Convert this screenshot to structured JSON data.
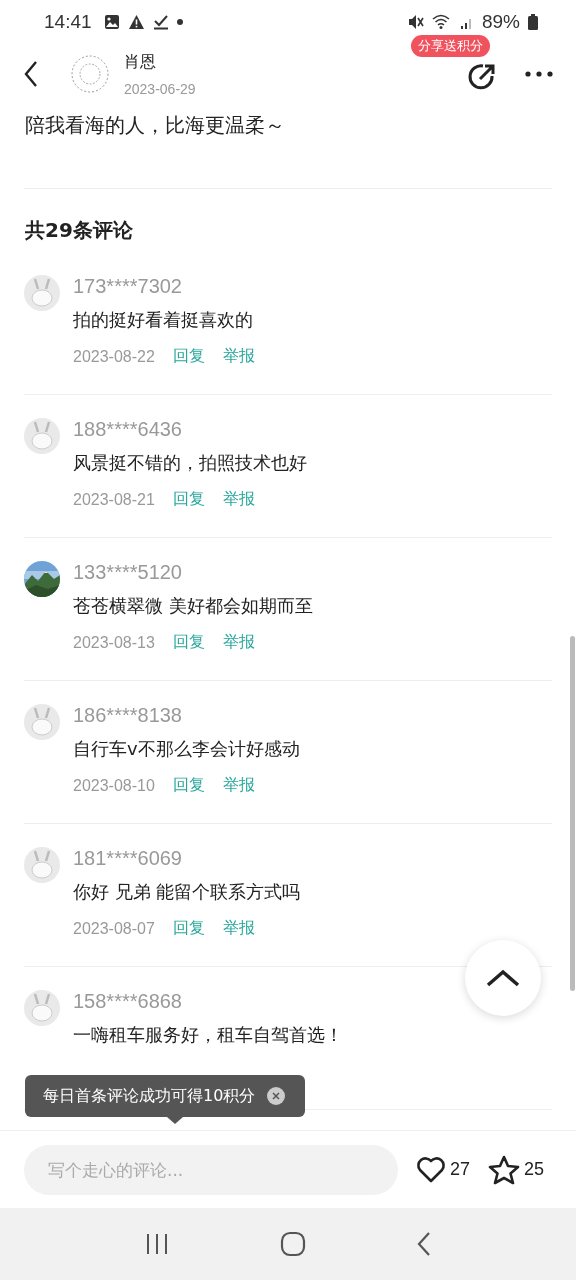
{
  "status_bar": {
    "time": "14:41",
    "battery": "89%"
  },
  "post": {
    "author": "肖恩",
    "date": "2023-06-29",
    "share_badge": "分享送积分",
    "text": "陪我看海的人，比海更温柔～"
  },
  "comments_heading": "共29条评论",
  "comments": [
    {
      "kind": "rabbit",
      "user": "173****7302",
      "text": "拍的挺好看着挺喜欢的",
      "date": "2023-08-22",
      "reply": "回复",
      "report": "举报"
    },
    {
      "kind": "rabbit",
      "user": "188****6436",
      "text": "风景挺不错的，拍照技术也好",
      "date": "2023-08-21",
      "reply": "回复",
      "report": "举报"
    },
    {
      "user": "133****5120",
      "text": "苍苍横翠微 美好都会如期而至",
      "date": "2023-08-13",
      "reply": "回复",
      "report": "举报"
    },
    {
      "kind": "rabbit",
      "user": "186****8138",
      "text": "自行车v不那么李会计好感动",
      "date": "2023-08-10",
      "reply": "回复",
      "report": "举报"
    },
    {
      "kind": "rabbit",
      "user": "181****6069",
      "text": "你好 兄弟 能留个联系方式吗",
      "date": "2023-08-07",
      "reply": "回复",
      "report": "举报"
    },
    {
      "kind": "rabbit",
      "user": "158****6868",
      "text": "一嗨租车服务好，租车自驾首选！"
    }
  ],
  "toast": {
    "text": "每日首条评论成功可得10积分"
  },
  "comment_bar": {
    "placeholder": "写个走心的评论...",
    "likes": "27",
    "favorites": "25"
  }
}
